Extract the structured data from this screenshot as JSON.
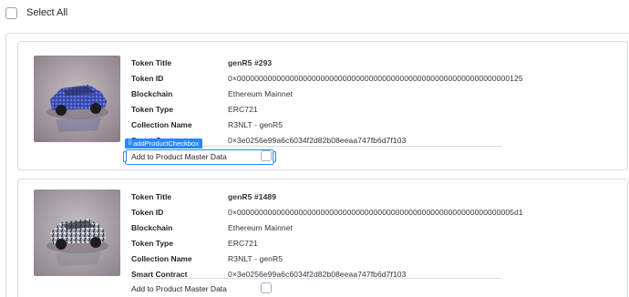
{
  "select_all": {
    "label": "Select All"
  },
  "field_labels": {
    "token_title": "Token Title",
    "token_id": "Token ID",
    "blockchain": "Blockchain",
    "token_type": "Token Type",
    "collection_name": "Collection Name",
    "smart_contract": "Smart Contract"
  },
  "add_to_master_label": "Add to Product Master Data",
  "inspector_tag": "addProductCheckbox",
  "tokens": [
    {
      "title": "genR5 #293",
      "token_id": "0×00000000000000000000000000000000000000000000000000000000000000125",
      "blockchain": "Ethereum Mainnet",
      "token_type": "ERC721",
      "collection_name": "R3NLT - genR5",
      "smart_contract": "0×3e0256e99a6c6034f2d82b08eeaa747fb6d7f103"
    },
    {
      "title": "genR5 #1489",
      "token_id": "0×000000000000000000000000000000000000000000000000000000000000005d1",
      "blockchain": "Ethereum Mainnet",
      "token_type": "ERC721",
      "collection_name": "R3NLT - genR5",
      "smart_contract": "0×3e0256e99a6c6034f2d82b08eeaa747fb6d7f103"
    }
  ],
  "colors": {
    "accent": "#2a86ff",
    "border": "#d7dbe0"
  },
  "icons": {
    "car_1": "blue-patterned-car-image",
    "car_2": "grey-camo-car-image"
  }
}
